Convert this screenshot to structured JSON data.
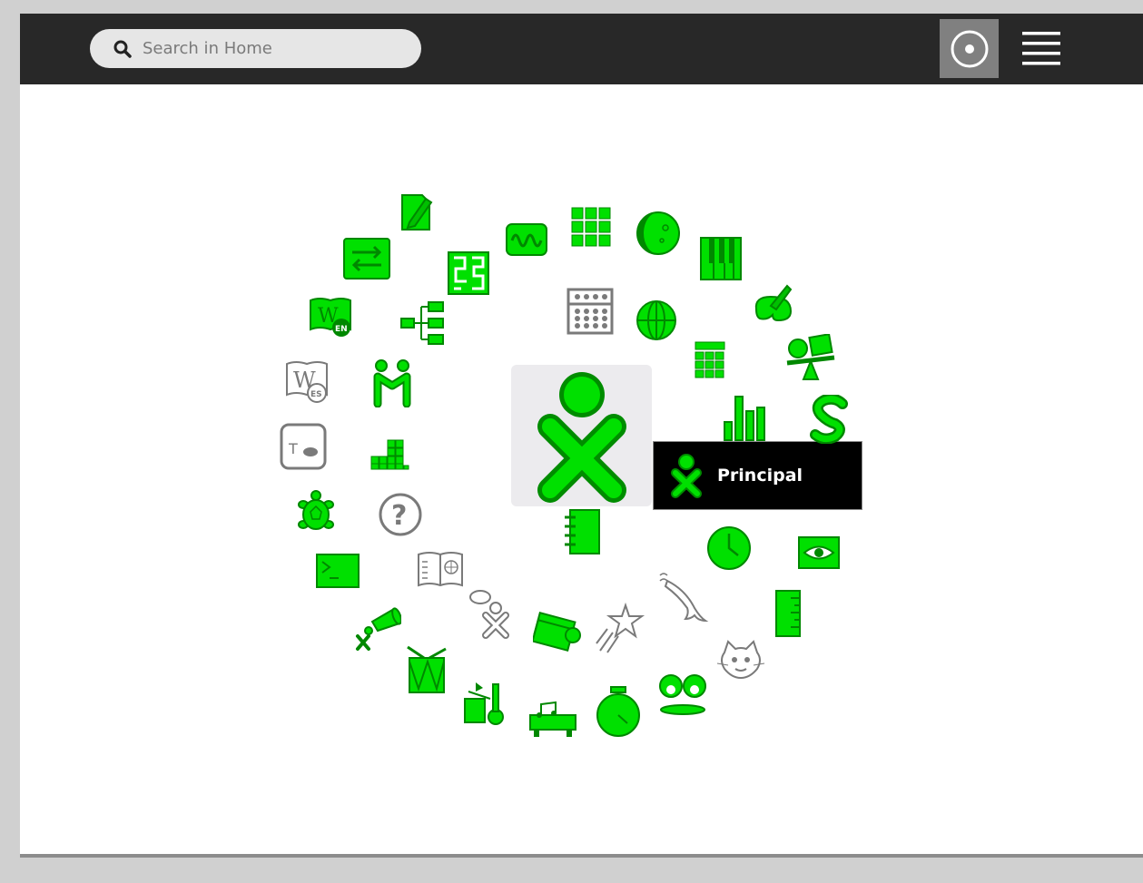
{
  "search": {
    "placeholder": "Search in Home"
  },
  "tooltip": {
    "label": "Principal"
  },
  "icon_badges": {
    "wikipedia_en": "EN",
    "wikipedia_es": "ES",
    "typing_turtle": "T"
  },
  "colors": {
    "accent_green": "#00e000",
    "dark_green": "#008800",
    "gray": "#808080",
    "topbar": "#282828"
  }
}
